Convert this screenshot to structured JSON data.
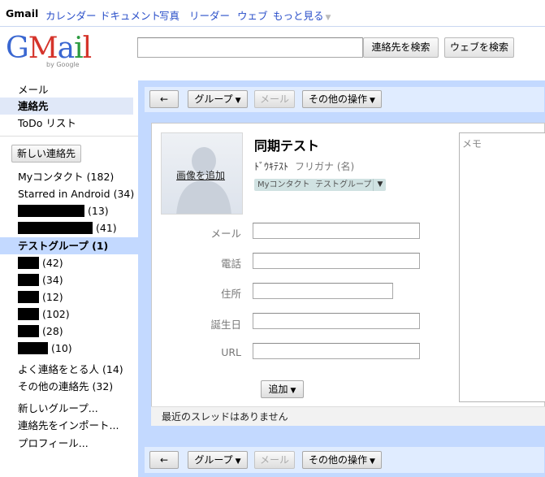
{
  "topnav": {
    "items": [
      "Gmail",
      "カレンダー",
      "ドキュメント",
      "写真",
      "リーダー",
      "ウェブ",
      "もっと見る"
    ],
    "more_arrow": "▼"
  },
  "logo": {
    "g": "G",
    "m": "M",
    "a": "a",
    "i": "i",
    "l": "l",
    "by": "by Google"
  },
  "search": {
    "value": "",
    "contacts_button": "連絡先を検索",
    "web_button": "ウェブを検索"
  },
  "leftnav": {
    "top_items": [
      "メール",
      "連絡先",
      "ToDo リスト"
    ],
    "selected_index": 1,
    "new_contact": "新しい連絡先",
    "groups": [
      {
        "label": "Myコンタクト",
        "count": "(182)",
        "redacted": false
      },
      {
        "label": "Starred in Android",
        "count": "(34)",
        "redacted": false
      },
      {
        "label": "",
        "count": "(13)",
        "redacted": true
      },
      {
        "label": "",
        "count": "(41)",
        "redacted": true
      },
      {
        "label": "テストグループ",
        "count": "(1)",
        "redacted": false
      },
      {
        "label": "",
        "count": "(42)",
        "redacted": true
      },
      {
        "label": "",
        "count": "(34)",
        "redacted": true
      },
      {
        "label": "",
        "count": "(12)",
        "redacted": true
      },
      {
        "label": "",
        "count": "(102)",
        "redacted": true
      },
      {
        "label": "",
        "count": "(28)",
        "redacted": true
      },
      {
        "label": "",
        "count": "(10)",
        "redacted": true
      }
    ],
    "selected_group_index": 4,
    "extra": [
      {
        "label": "よく連絡をとる人",
        "count": "(14)"
      },
      {
        "label": "その他の連絡先",
        "count": "(32)"
      }
    ],
    "actions": [
      "新しいグループ...",
      "連絡先をインポート...",
      "プロフィール..."
    ]
  },
  "toolbar": {
    "back": "←",
    "group": "グループ",
    "mail": "メール",
    "more_actions": "その他の操作",
    "dropdown": "▼"
  },
  "contact": {
    "name": "同期テスト",
    "reading": "ﾄﾞｳｷﾃｽﾄ",
    "furigana_placeholder": "フリガナ (名)",
    "add_photo": "画像を追加",
    "chips": [
      "Myコンタクト",
      "テストグループ"
    ],
    "chip_dropdown": "▼",
    "fields": [
      {
        "label": "メール",
        "value": ""
      },
      {
        "label": "電話",
        "value": ""
      },
      {
        "label": "住所",
        "value": ""
      },
      {
        "label": "誕生日",
        "value": ""
      },
      {
        "label": "URL",
        "value": ""
      }
    ],
    "add_button": "追加",
    "memo_placeholder": "メモ",
    "recent_threads": "最近のスレッドはありません"
  },
  "colors": {
    "accent": "#c3d9ff",
    "link": "#2a4fc9",
    "selected_nav": "#e0e8f8",
    "chip": "#d0e2e2"
  }
}
